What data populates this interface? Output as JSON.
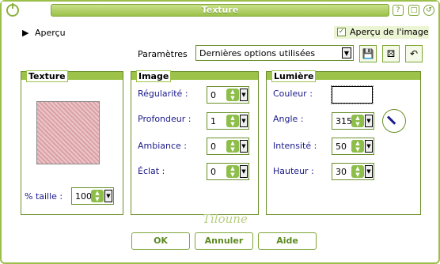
{
  "window": {
    "title": "Texture"
  },
  "preview": {
    "label": "Aperçu",
    "checkbox_label": "Aperçu de l'image",
    "checked": true
  },
  "parametres": {
    "label": "Paramètres",
    "value": "Dernières options utilisées"
  },
  "texture": {
    "title": "Texture",
    "size_label": "% taille :",
    "size_value": "100"
  },
  "image": {
    "title": "Image",
    "fields": [
      {
        "label": "Régularité :",
        "value": "0"
      },
      {
        "label": "Profondeur :",
        "value": "1"
      },
      {
        "label": "Ambiance :",
        "value": "0"
      },
      {
        "label": "Éclat :",
        "value": "0"
      }
    ]
  },
  "lumiere": {
    "title": "Lumière",
    "couleur_label": "Couleur :",
    "fields": [
      {
        "label": "Angle :",
        "value": "315"
      },
      {
        "label": "Intensité :",
        "value": "50"
      },
      {
        "label": "Hauteur :",
        "value": "30"
      }
    ]
  },
  "buttons": {
    "ok": "OK",
    "cancel": "Annuler",
    "help": "Aide"
  },
  "watermark": "Tiloune",
  "colors": {
    "accent": "#9cc24a",
    "border": "#6a8f2a",
    "label_blue": "#1a1a8c"
  }
}
